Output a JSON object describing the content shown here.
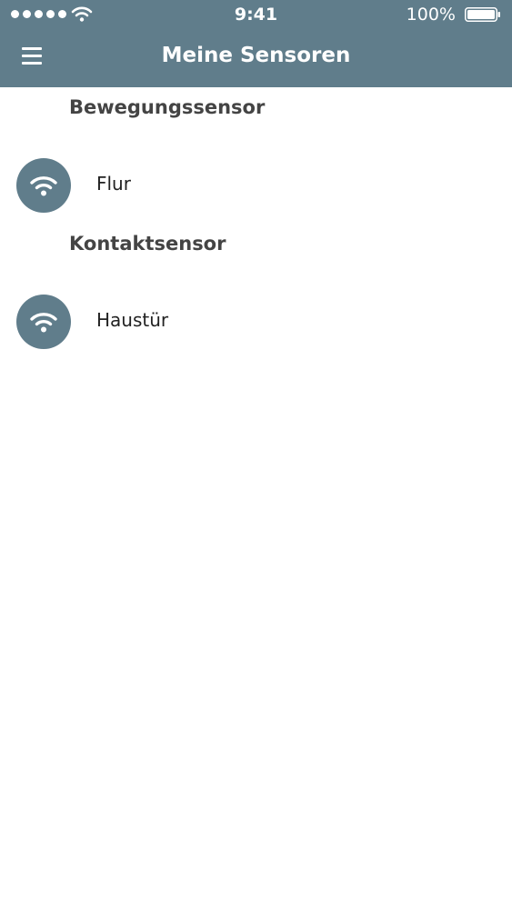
{
  "status_bar": {
    "time": "9:41",
    "battery_percent": "100%",
    "signal_bars": 5,
    "icons": [
      "cellular-signal-icon",
      "wifi-icon",
      "battery-icon"
    ]
  },
  "nav": {
    "title": "Meine Sensoren",
    "menu_icon": "hamburger-menu-icon"
  },
  "sections": [
    {
      "header": "Bewegungssensor",
      "sensors": [
        {
          "label": "Flur",
          "icon": "wifi-icon"
        }
      ]
    },
    {
      "header": "Kontaktsensor",
      "sensors": [
        {
          "label": "Haustür",
          "icon": "wifi-icon"
        }
      ]
    }
  ],
  "colors": {
    "primary": "#607d8b",
    "background": "#ffffff",
    "header_text": "#444444",
    "item_text": "#222222"
  }
}
